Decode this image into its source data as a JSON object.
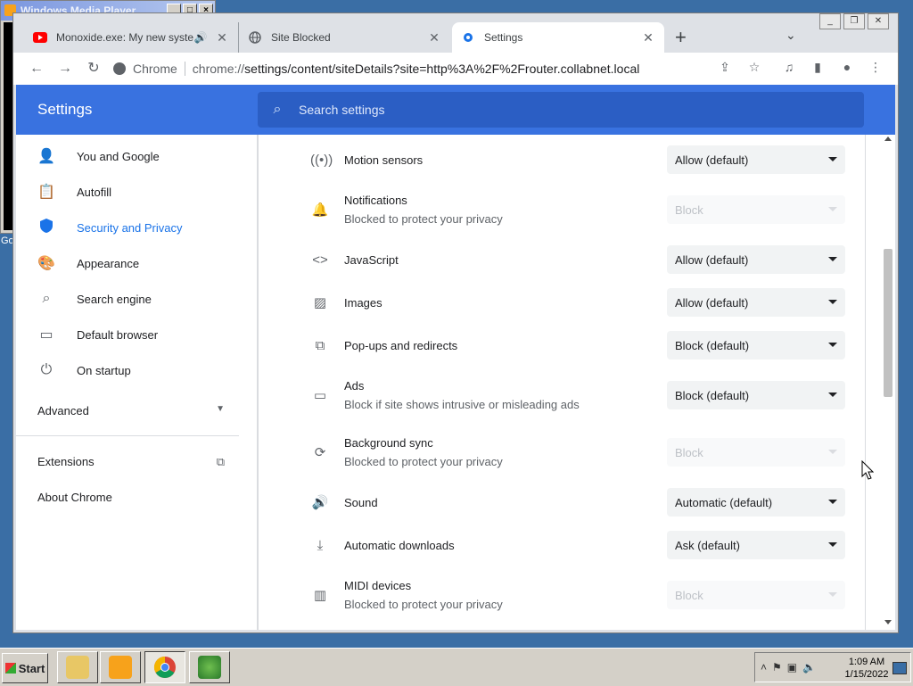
{
  "background_window": {
    "title": "Windows Media Player",
    "taskbar_peek": "Go"
  },
  "browser": {
    "tabs": [
      {
        "label": "Monoxide.exe: My new system",
        "favicon": "youtube-icon",
        "muted_icon": "speaker-icon",
        "active": false
      },
      {
        "label": "Site Blocked",
        "favicon": "globe-icon",
        "active": false
      },
      {
        "label": "Settings",
        "favicon": "gear-icon",
        "active": true
      }
    ],
    "new_tab_label": "+",
    "omnibox": {
      "chip": "Chrome",
      "url_scheme": "chrome://",
      "url_rest": "settings/content/siteDetails?site=http%3A%2F%2Frouter.collabnet.local"
    }
  },
  "settings": {
    "header_title": "Settings",
    "search_placeholder": "Search settings",
    "sidebar": {
      "items": [
        {
          "label": "You and Google",
          "icon": "person-icon"
        },
        {
          "label": "Autofill",
          "icon": "clipboard-icon"
        },
        {
          "label": "Security and Privacy",
          "icon": "shield-icon",
          "active": true
        },
        {
          "label": "Appearance",
          "icon": "palette-icon"
        },
        {
          "label": "Search engine",
          "icon": "search-icon"
        },
        {
          "label": "Default browser",
          "icon": "browser-icon"
        },
        {
          "label": "On startup",
          "icon": "power-icon"
        }
      ],
      "advanced": "Advanced",
      "extensions": "Extensions",
      "about": "About Chrome"
    },
    "permissions": [
      {
        "label": "Motion sensors",
        "sub": "",
        "value": "Allow (default)",
        "disabled": false,
        "icon": "sensors-icon"
      },
      {
        "label": "Notifications",
        "sub": "Blocked to protect your privacy",
        "value": "Block",
        "disabled": true,
        "icon": "bell-icon"
      },
      {
        "label": "JavaScript",
        "sub": "",
        "value": "Allow (default)",
        "disabled": false,
        "icon": "code-icon"
      },
      {
        "label": "Images",
        "sub": "",
        "value": "Allow (default)",
        "disabled": false,
        "icon": "image-icon"
      },
      {
        "label": "Pop-ups and redirects",
        "sub": "",
        "value": "Block (default)",
        "disabled": false,
        "icon": "open-external-icon"
      },
      {
        "label": "Ads",
        "sub": "Block if site shows intrusive or misleading ads",
        "value": "Block (default)",
        "disabled": false,
        "icon": "ads-window-icon"
      },
      {
        "label": "Background sync",
        "sub": "Blocked to protect your privacy",
        "value": "Block",
        "disabled": true,
        "icon": "sync-icon"
      },
      {
        "label": "Sound",
        "sub": "",
        "value": "Automatic (default)",
        "disabled": false,
        "icon": "volume-icon"
      },
      {
        "label": "Automatic downloads",
        "sub": "",
        "value": "Ask (default)",
        "disabled": false,
        "icon": "download-icon"
      },
      {
        "label": "MIDI devices",
        "sub": "Blocked to protect your privacy",
        "value": "Block",
        "disabled": true,
        "icon": "piano-icon"
      }
    ]
  },
  "taskbar": {
    "start_label": "Start",
    "clock_time": "1:09 AM",
    "clock_date": "1/15/2022"
  },
  "colors": {
    "header_blue": "#3972e0",
    "accent_blue": "#1a73e8",
    "desktop": "#3a6ea5"
  }
}
